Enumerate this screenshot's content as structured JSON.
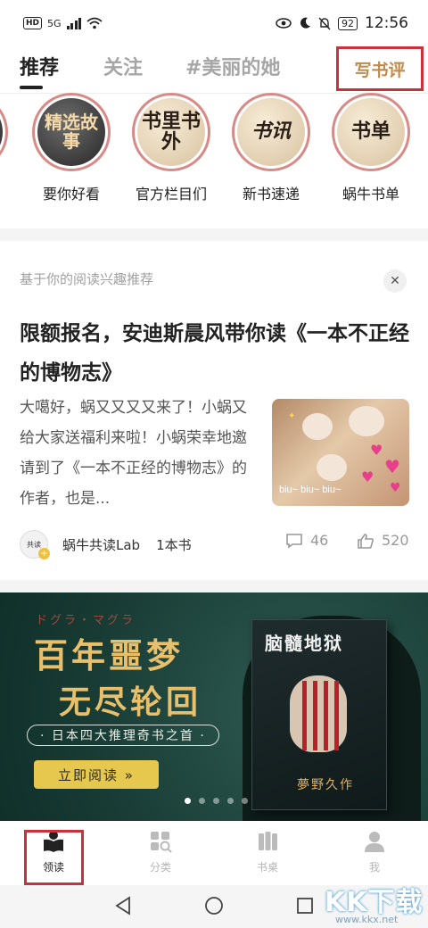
{
  "status_bar": {
    "hd": "HD",
    "network": "5G",
    "battery": "92",
    "time": "12:56"
  },
  "tabs": [
    {
      "label": "推荐",
      "active": true
    },
    {
      "label": "关注",
      "active": false
    },
    {
      "label": "#美丽的她",
      "active": false
    }
  ],
  "write_review_label": "写书评",
  "circles": [
    {
      "art": "精选故事",
      "label": "要你好看"
    },
    {
      "art": "书里书外",
      "label": "官方栏目们"
    },
    {
      "art": "书讯",
      "label": "新书速递"
    },
    {
      "art": "书单",
      "label": "蜗牛书单"
    }
  ],
  "card": {
    "hint": "基于你的阅读兴趣推荐",
    "close_icon": "close-icon",
    "title": "限额报名，安迪斯晨风带你读《一本不正经的博物志》",
    "body": "大噶好，蜗又又又又来了！小蜗又给大家送福利来啦！小蜗荣幸地邀请到了《一本不正经的博物志》的作者，也是...",
    "thumb_caption": "biu~ biu~ biu~",
    "author": "蜗牛共读Lab",
    "book_count": "1本书",
    "comments": "46",
    "likes": "520"
  },
  "banner": {
    "jp_text": "ドグラ・マグラ",
    "line1": "百年噩梦",
    "line2": "无尽轮回",
    "tagline": "· 日本四大推理奇书之首 ·",
    "read_button": "立即阅读 »",
    "book_title": "脑髓地狱",
    "book_author": "夢野久作",
    "slide_count": 5,
    "active_slide": 0
  },
  "bottom_nav": [
    {
      "label": "领读",
      "icon": "book-reading-icon",
      "active": true
    },
    {
      "label": "分类",
      "icon": "category-grid-icon",
      "active": false
    },
    {
      "label": "书桌",
      "icon": "bookshelf-icon",
      "active": false
    },
    {
      "label": "我",
      "icon": "user-icon",
      "active": false
    }
  ],
  "watermark": {
    "text": "KK下载",
    "url": "www.kkx.net"
  },
  "colors": {
    "highlight_red": "#c8323a",
    "gold": "#c18a4a",
    "banner_green": "#173a33",
    "button_yellow": "#e6c84e"
  }
}
